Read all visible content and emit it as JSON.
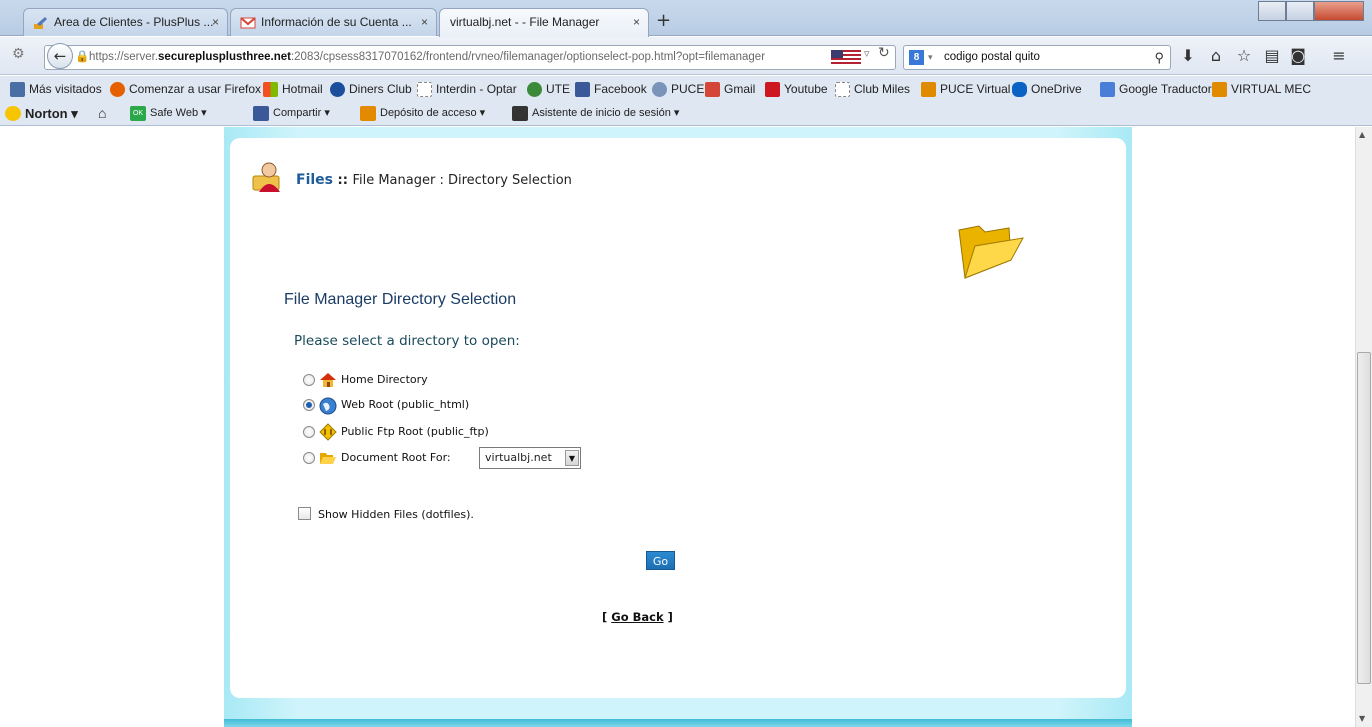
{
  "browser": {
    "tabs": [
      {
        "title": "Area de Clientes - PlusPlus ...",
        "icon": "pencil-icon",
        "close": "×"
      },
      {
        "title": "Información de su Cuenta ...",
        "icon": "gmail-icon",
        "close": "×"
      },
      {
        "title": "virtualbj.net - - File Manager",
        "icon": "",
        "close": "×"
      }
    ],
    "new_tab": "+",
    "url_host_pre": "https://server.",
    "url_host_bold": "secureplusplusthree.net",
    "url_rest": ":2083/cpsess8317070162/frontend/rvneo/filemanager/optionselect-pop.html?opt=filemanager",
    "search_value": "codigo postal quito"
  },
  "bookmarks": [
    {
      "label": "Más visitados",
      "color": "#4a6fa5"
    },
    {
      "label": "Comenzar a usar Firefox",
      "color": "#e66000"
    },
    {
      "label": "Hotmail",
      "color": "#f25022"
    },
    {
      "label": "Diners Club",
      "color": "#1b4f9c"
    },
    {
      "label": "Interdin - Optar",
      "color": "#ffffff"
    },
    {
      "label": "UTE",
      "color": "#3a8a3a"
    },
    {
      "label": "Facebook",
      "color": "#3b5998"
    },
    {
      "label": "PUCE",
      "color": "#7a93b8"
    },
    {
      "label": "Gmail",
      "color": "#d44638"
    },
    {
      "label": "Youtube",
      "color": "#cc181e"
    },
    {
      "label": "Club Miles",
      "color": "#ffffff"
    },
    {
      "label": "PUCE Virtual",
      "color": "#e08a00"
    },
    {
      "label": "OneDrive",
      "color": "#0a62c5"
    },
    {
      "label": "Google Traductor",
      "color": "#4a7fd8"
    },
    {
      "label": "VIRTUAL MEC",
      "color": "#e08a00"
    }
  ],
  "norton_toolbar": {
    "norton_label": "Norton",
    "safe_web": "Safe Web",
    "share": "Compartir",
    "deposit": "Depósito de acceso",
    "login_assistant": "Asistente de inicio de sesión",
    "ok_badge": "OK"
  },
  "page": {
    "breadcrumb": {
      "files": "Files",
      "sep": " :: ",
      "rest": "File Manager : Directory Selection"
    },
    "section_title": "File Manager Directory Selection",
    "prompt": "Please select a directory to open:",
    "options": [
      {
        "label": "Home Directory",
        "icon": "home-icon",
        "checked": false
      },
      {
        "label": "Web Root (public_html)",
        "icon": "globe-icon",
        "checked": true
      },
      {
        "label": "Public Ftp Root (public_ftp)",
        "icon": "ftp-icon",
        "checked": false
      },
      {
        "label": "Document Root For:",
        "icon": "open-folder-icon",
        "checked": false
      }
    ],
    "doc_root_select": "virtualbj.net",
    "show_hidden": "Show Hidden Files (dotfiles).",
    "go_button": "Go",
    "go_back_open": "[ ",
    "go_back": "Go Back",
    "go_back_close": " ]"
  },
  "colors": {
    "frame_cyan": "#cff4fb",
    "link_blue": "#1f5c99",
    "go_button": "#1d6fb2"
  }
}
